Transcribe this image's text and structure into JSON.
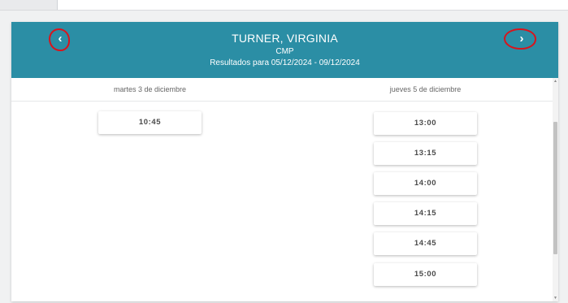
{
  "header": {
    "name": "TURNER, VIRGINIA",
    "code": "CMP",
    "range": "Resultados para 05/12/2024 - 09/12/2024",
    "prev_icon": "chevron-left-icon",
    "next_icon": "chevron-right-icon",
    "background_color": "#2b8ea5",
    "annotation_color": "#d9141c"
  },
  "columns": [
    {
      "label": "martes 3 de diciembre",
      "slots": [
        "10:45"
      ]
    },
    {
      "label": "jueves 5 de diciembre",
      "slots": [
        "13:00",
        "13:15",
        "14:00",
        "14:15",
        "14:45",
        "15:00"
      ]
    }
  ]
}
